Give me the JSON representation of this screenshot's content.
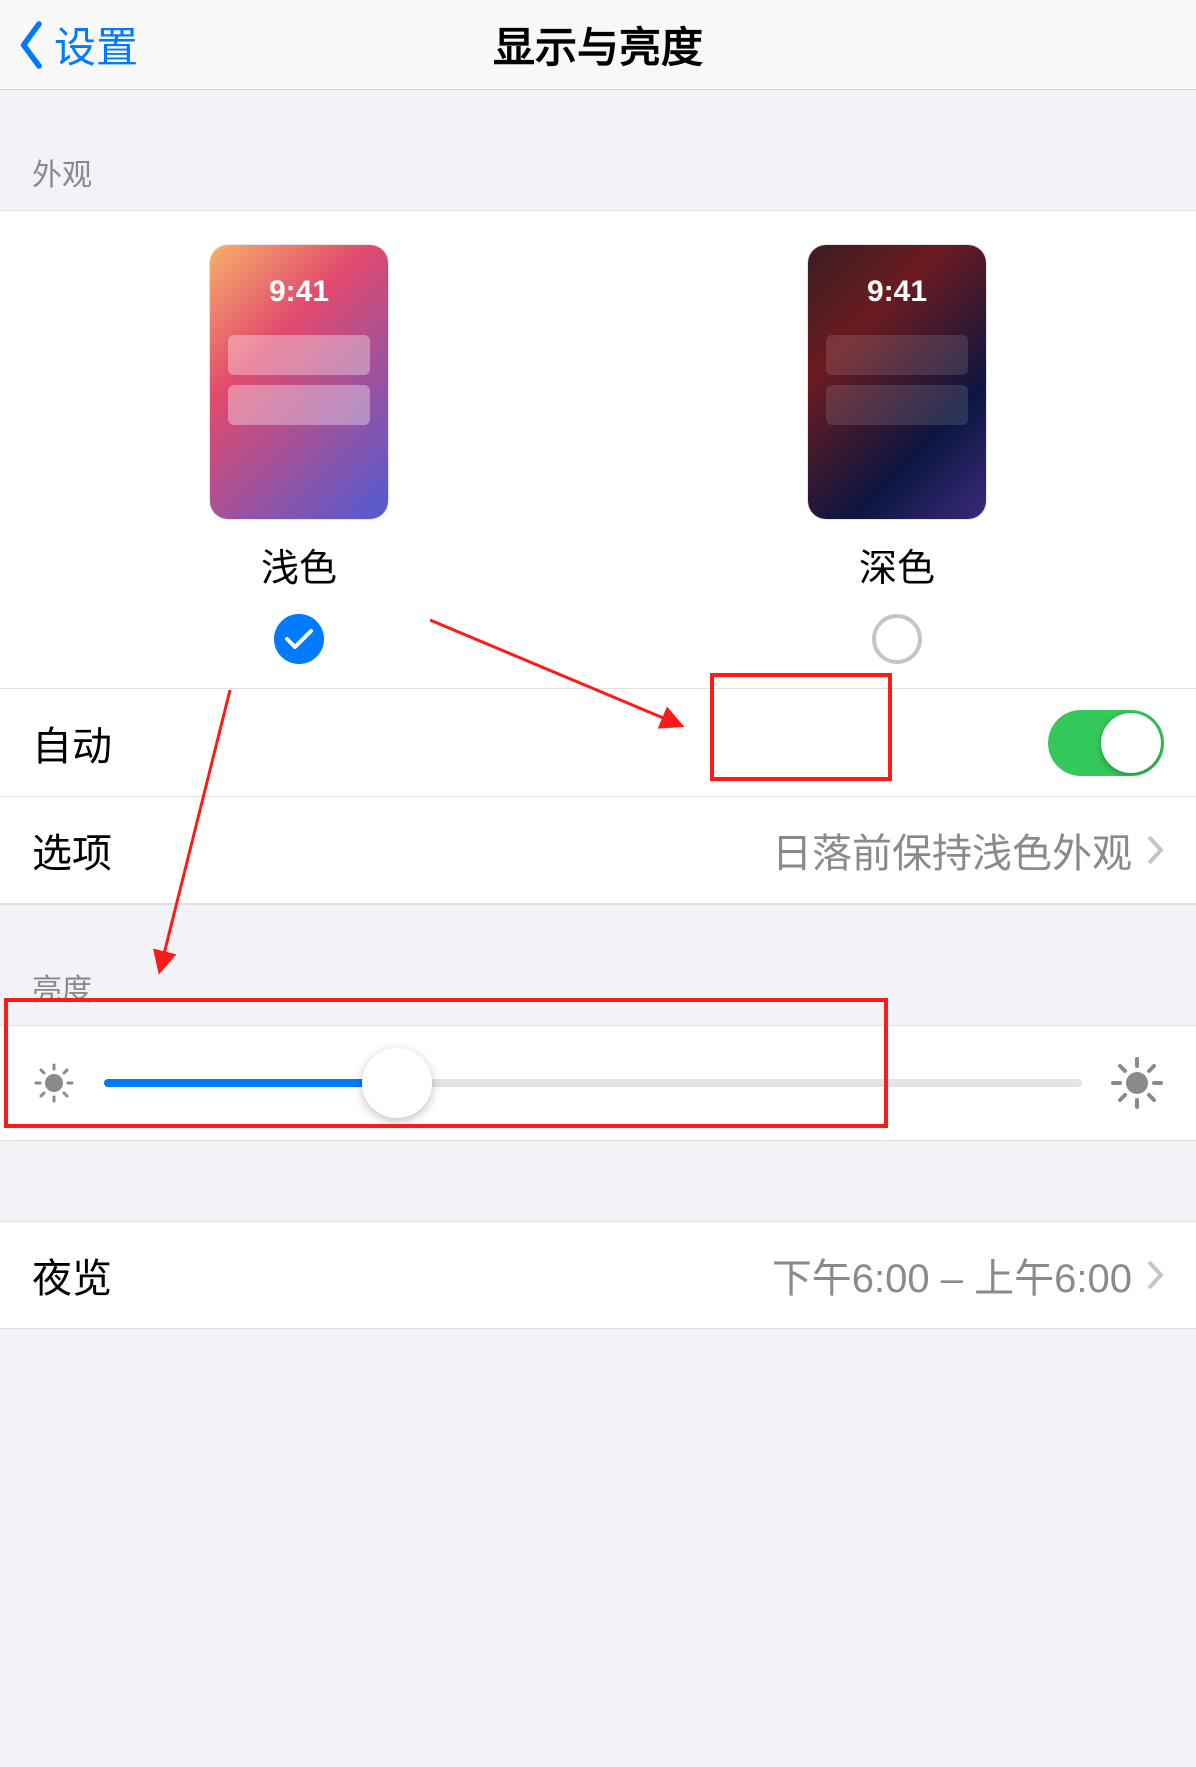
{
  "header": {
    "back_label": "设置",
    "title": "显示与亮度"
  },
  "appearance": {
    "section_title": "外观",
    "preview_clock": "9:41",
    "light_label": "浅色",
    "dark_label": "深色",
    "selected": "light"
  },
  "auto": {
    "label": "自动",
    "enabled": true
  },
  "options": {
    "label": "选项",
    "value": "日落前保持浅色外观"
  },
  "brightness": {
    "section_title": "亮度",
    "value_percent": 30
  },
  "night_shift": {
    "label": "夜览",
    "value": "下午6:00 – 上午6:00"
  },
  "colors": {
    "accent": "#007aff",
    "switch_on": "#34c759"
  }
}
